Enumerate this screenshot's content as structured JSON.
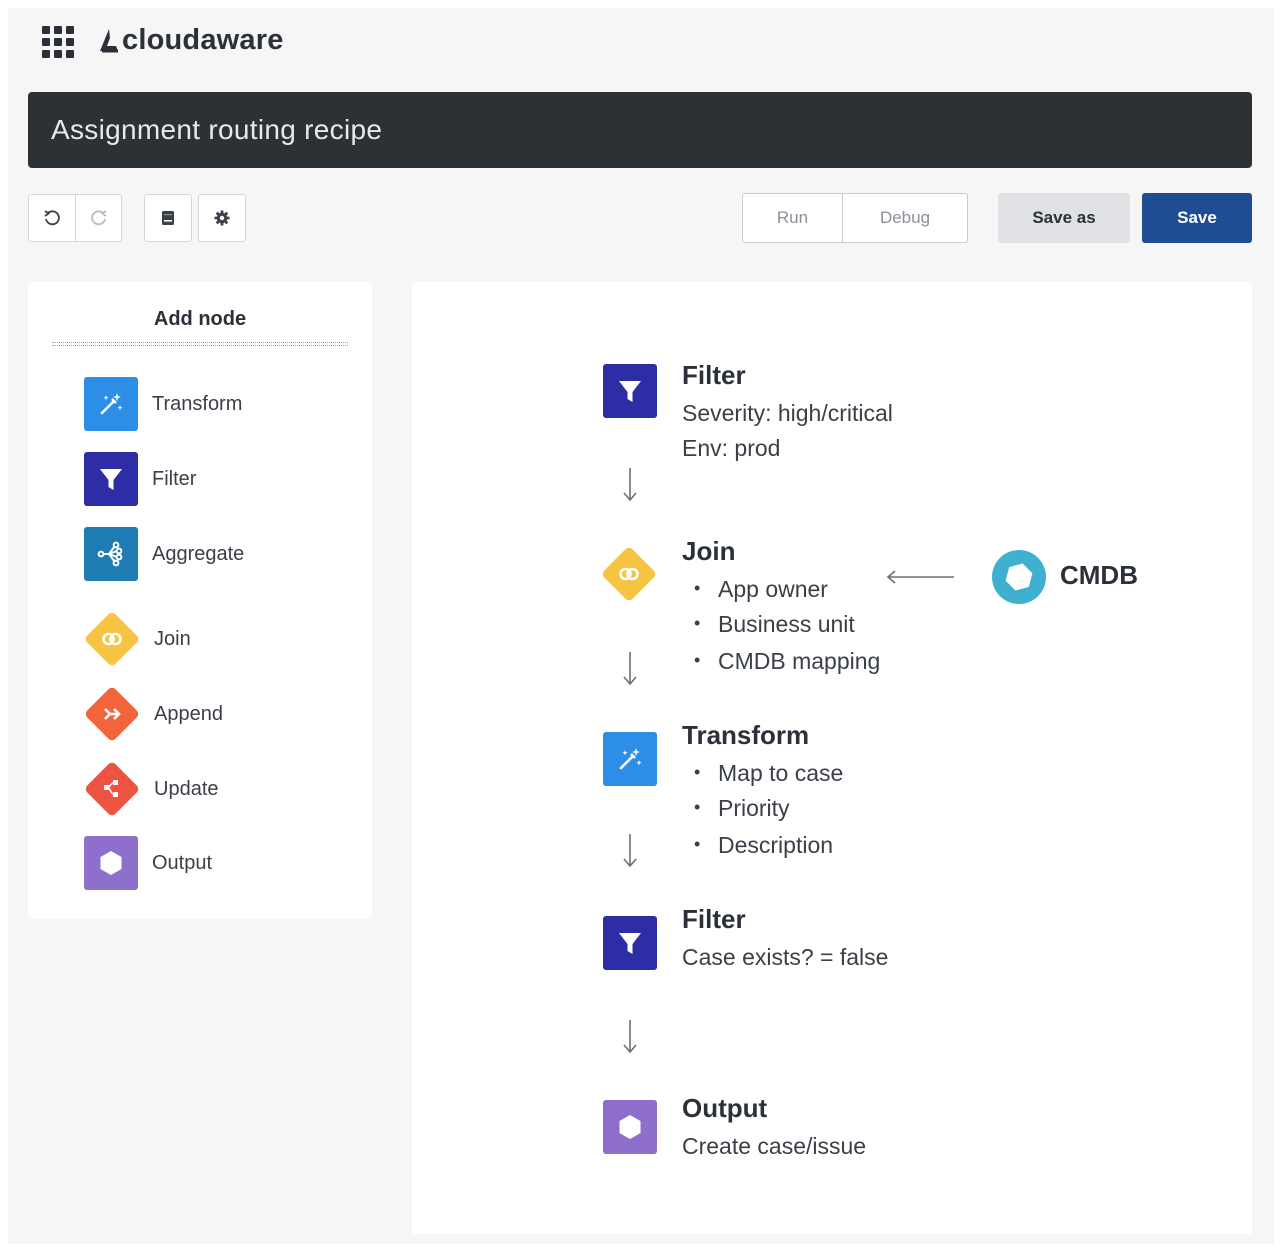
{
  "header": {
    "brand": "cloudaware",
    "recipe_title": "Assignment routing recipe"
  },
  "toolbar": {
    "run_label": "Run",
    "debug_label": "Debug",
    "save_as_label": "Save as",
    "save_label": "Save"
  },
  "palette": {
    "title": "Add node",
    "items": [
      {
        "label": "Transform",
        "icon": "magic-wand-icon",
        "color": "#2d8ee8"
      },
      {
        "label": "Filter",
        "icon": "funnel-icon",
        "color": "#2d2ea6"
      },
      {
        "label": "Aggregate",
        "icon": "aggregate-icon",
        "color": "#1f7cb3"
      },
      {
        "label": "Join",
        "icon": "join-icon",
        "color": "#f7c343"
      },
      {
        "label": "Append",
        "icon": "append-icon",
        "color": "#f2643b"
      },
      {
        "label": "Update",
        "icon": "update-icon",
        "color": "#ed5342"
      },
      {
        "label": "Output",
        "icon": "hexagon-icon",
        "color": "#8e70cc"
      }
    ]
  },
  "flow": {
    "nodes": [
      {
        "title": "Filter",
        "lines": [
          "Severity: high/critical",
          "Env: prod"
        ]
      },
      {
        "title": "Join",
        "bullets": [
          "App owner",
          "Business unit",
          "CMDB mapping"
        ]
      },
      {
        "title": "Transform",
        "bullets": [
          "Map to case",
          "Priority",
          "Description"
        ]
      },
      {
        "title": "Filter",
        "lines": [
          "Case exists? = false"
        ]
      },
      {
        "title": "Output",
        "lines": [
          "Create case/issue"
        ]
      }
    ],
    "source": {
      "label": "CMDB",
      "icon": "ring-icon",
      "color": "#3fb0cf"
    }
  }
}
